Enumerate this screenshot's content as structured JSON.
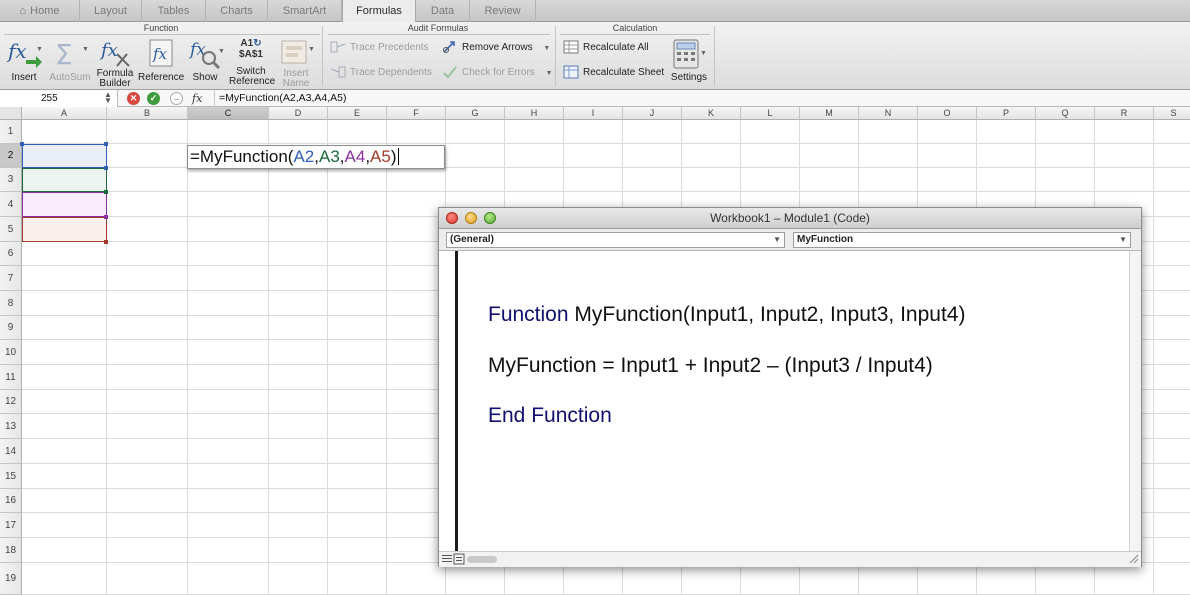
{
  "tabs": [
    {
      "label": "Home",
      "active": false
    },
    {
      "label": "Layout",
      "active": false
    },
    {
      "label": "Tables",
      "active": false
    },
    {
      "label": "Charts",
      "active": false
    },
    {
      "label": "SmartArt",
      "active": false
    },
    {
      "label": "Formulas",
      "active": true
    },
    {
      "label": "Data",
      "active": false
    },
    {
      "label": "Review",
      "active": false
    }
  ],
  "ribbon": {
    "groups": {
      "function": "Function",
      "audit": "Audit Formulas",
      "calculation": "Calculation"
    },
    "function_buttons": {
      "insert": "Insert",
      "autosum": "AutoSum",
      "formula_builder_1": "Formula",
      "formula_builder_2": "Builder",
      "reference": "Reference",
      "show": "Show",
      "switch_1": "Switch",
      "switch_2": "Reference",
      "switch_icon_top": "A1",
      "switch_icon_bottom": "$A$1",
      "insert_name_1": "Insert",
      "insert_name_2": "Name"
    },
    "audit_buttons": {
      "trace_precedents": "Trace Precedents",
      "trace_dependents": "Trace Dependents",
      "remove_arrows": "Remove Arrows",
      "check_errors": "Check for Errors"
    },
    "calc_buttons": {
      "recalc_all": "Recalculate All",
      "recalc_sheet": "Recalculate Sheet",
      "settings": "Settings"
    }
  },
  "formula_bar": {
    "name_box": "255",
    "fx": "fx",
    "formula": "=MyFunction(A2,A3,A4,A5)"
  },
  "grid": {
    "columns": [
      "A",
      "B",
      "C",
      "D",
      "E",
      "F",
      "G",
      "H",
      "I",
      "J",
      "K",
      "L",
      "M",
      "N",
      "O",
      "P",
      "Q",
      "R",
      "S"
    ],
    "rows": [
      "1",
      "2",
      "3",
      "4",
      "5",
      "6",
      "7",
      "8",
      "9",
      "10",
      "11",
      "12",
      "13",
      "14",
      "15",
      "16",
      "17",
      "18",
      "19"
    ],
    "selected_column": "C",
    "selected_row": "2"
  },
  "cell_edit": {
    "prefix": "=MyFunction(",
    "ref1": "A2",
    "comma1": ",",
    "ref2": "A3",
    "comma2": ",",
    "ref3": "A4",
    "comma3": ",",
    "ref4": "A5",
    "suffix": ")",
    "ref_colors": [
      "#2f5fb3",
      "#1b6a3a",
      "#8c2fa5",
      "#a33b2a"
    ]
  },
  "code_window": {
    "title": "Workbook1 – Module1 (Code)",
    "object_dropdown": "(General)",
    "procedure_dropdown": "MyFunction",
    "lines": [
      {
        "keyword": "Function",
        "rest": " MyFunction(Input1, Input2, Input3, Input4)"
      },
      {
        "keyword": "",
        "rest": "MyFunction = Input1 + Input2 – (Input3 / Input4)"
      },
      {
        "keyword": "End Function",
        "rest": ""
      }
    ]
  }
}
